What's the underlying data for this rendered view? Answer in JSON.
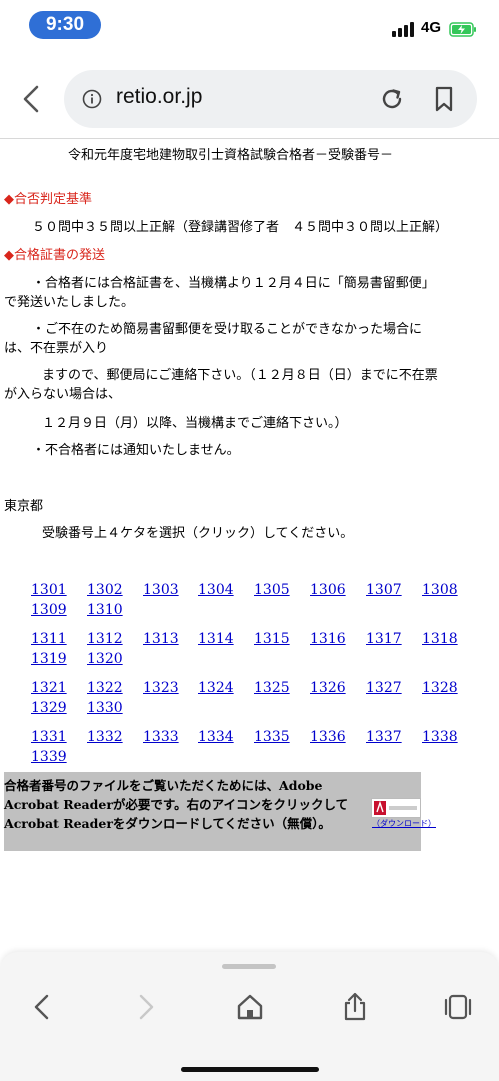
{
  "status_bar": {
    "time": "9:30",
    "network": "4G"
  },
  "browser": {
    "url": "retio.or.jp"
  },
  "page": {
    "heading": "令和元年度宅地建物取引士資格試験合格者－受験番号－",
    "section1_title": "◆合否判定基準",
    "section1_body": "５０問中３５問以上正解（登録講習修了者　４５問中３０問以上正解）",
    "section2_title": "◆合格証書の発送",
    "bullet1": "・合格者には合格証書を、当機構より１２月４日に「簡易書留郵便」で発送いたしました。",
    "bullet2_line1": "・ご不在のため簡易書留郵便を受け取ることができなかった場合には、不在票が入り",
    "bullet2_line2": "ますので、郵便局にご連絡下さい。（１２月８日（日）までに不在票が入らない場合は、",
    "bullet2_line3": "１２月９日（月）以降、当機構までご連絡下さい。）",
    "bullet3": "・不合格者には通知いたしません。",
    "region": "東京都",
    "instruction": "受験番号上４ケタを選択（クリック）してください。",
    "number_rows": [
      [
        "1301",
        "1302",
        "1303",
        "1304",
        "1305",
        "1306",
        "1307",
        "1308",
        "1309",
        "1310"
      ],
      [
        "1311",
        "1312",
        "1313",
        "1314",
        "1315",
        "1316",
        "1317",
        "1318",
        "1319",
        "1320"
      ],
      [
        "1321",
        "1322",
        "1323",
        "1324",
        "1325",
        "1326",
        "1327",
        "1328",
        "1329",
        "1330"
      ],
      [
        "1331",
        "1332",
        "1333",
        "1334",
        "1335",
        "1336",
        "1337",
        "1338",
        "1339"
      ]
    ],
    "adobe_notice": "合格者番号のファイルをご覧いただくためには、Adobe Acrobat Readerが必要です。右のアイコンをクリックしてAcrobat Readerをダウンロードしてください（無償）。",
    "adobe_download_label": "（ダウンロード）"
  }
}
